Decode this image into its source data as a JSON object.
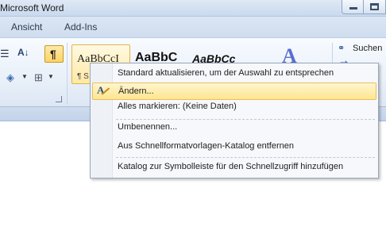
{
  "window": {
    "title": "Microsoft Word"
  },
  "tabs": [
    {
      "label": "Ansicht"
    },
    {
      "label": "Add-Ins"
    }
  ],
  "ribbon": {
    "styles": {
      "standard_sample": "AaBbCcI",
      "standard_sub": "¶ S",
      "no_spacing_sample": "AaBbC",
      "heading_sample": "AaBbCc"
    },
    "editing": {
      "find_label": "Suchen"
    }
  },
  "context_menu": {
    "items": [
      {
        "label": "Standard aktualisieren, um der Auswahl zu entsprechen",
        "highlighted": false
      },
      {
        "label": "Ändern...",
        "highlighted": true,
        "icon": "edit-style-icon"
      },
      {
        "label": "Alles markieren: (Keine Daten)",
        "highlighted": false
      },
      {
        "label": "Umbenennen...",
        "highlighted": false
      },
      {
        "label": "Aus Schnellformatvorlagen-Katalog entfernen",
        "highlighted": false
      },
      {
        "label": "Katalog zur Symbolleiste für den Schnellzugriff hinzufügen",
        "highlighted": false
      }
    ]
  },
  "colors": {
    "menu_highlight": "#ffe58f",
    "ribbon_bg": "#e9f0f9",
    "title_bar": "#dfe9f5"
  }
}
